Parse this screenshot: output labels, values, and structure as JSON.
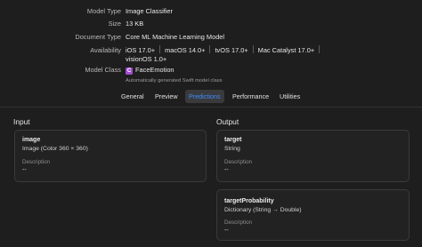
{
  "metadata": {
    "model_type": {
      "key": "Model Type",
      "value": "Image Classifier"
    },
    "size": {
      "key": "Size",
      "value": "13 KB"
    },
    "document_type": {
      "key": "Document Type",
      "value": "Core ML Machine Learning Model"
    },
    "availability": {
      "key": "Availability",
      "items": [
        "iOS 17.0+",
        "macOS 14.0+",
        "tvOS 17.0+",
        "Mac Catalyst 17.0+"
      ],
      "second_line": "visionOS 1.0+"
    },
    "model_class": {
      "key": "Model Class",
      "badge": "C",
      "value": "FaceEmotion",
      "note": "Automatically generated Swift model class"
    }
  },
  "tabs": [
    "General",
    "Preview",
    "Predictions",
    "Performance",
    "Utilities"
  ],
  "active_tab": "Predictions",
  "colors": {
    "accent": "#3d8eff",
    "class_badge": "#a24fd0",
    "background": "#1e1e1e"
  },
  "input": {
    "title": "Input",
    "features": [
      {
        "name": "image",
        "type": "Image (Color 360 × 360)",
        "description_label": "Description",
        "description": "--"
      }
    ]
  },
  "output": {
    "title": "Output",
    "features": [
      {
        "name": "target",
        "type": "String",
        "description_label": "Description",
        "description": "--"
      },
      {
        "name": "targetProbability",
        "type": "Dictionary (String → Double)",
        "description_label": "Description",
        "description": "--"
      }
    ]
  }
}
